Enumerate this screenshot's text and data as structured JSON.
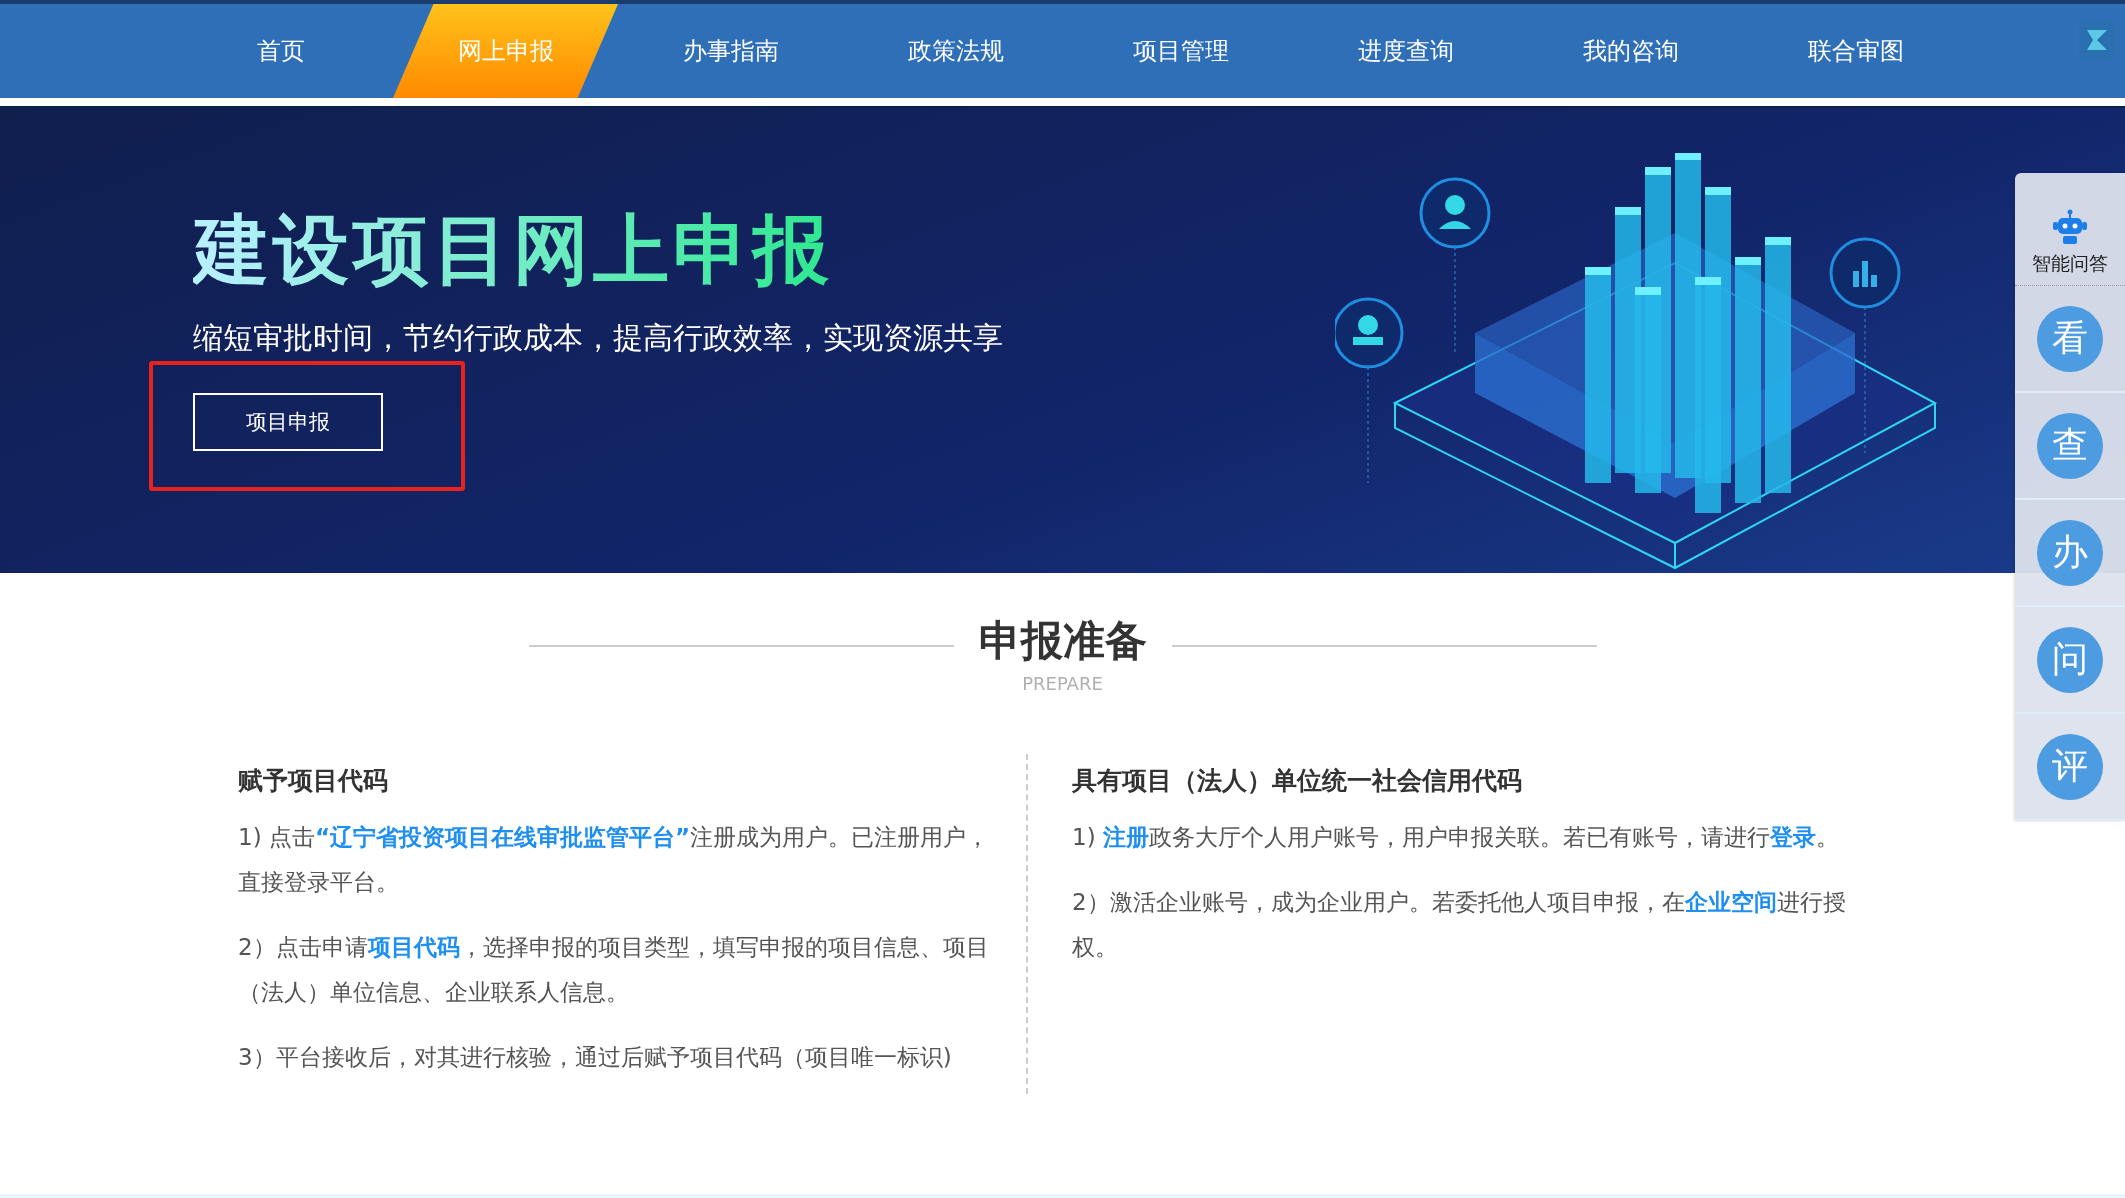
{
  "nav": {
    "items": [
      {
        "label": "首页",
        "selected": false
      },
      {
        "label": "网上申报",
        "selected": true
      },
      {
        "label": "办事指南",
        "selected": false
      },
      {
        "label": "政策法规",
        "selected": false
      },
      {
        "label": "项目管理",
        "selected": false
      },
      {
        "label": "进度查询",
        "selected": false
      },
      {
        "label": "我的咨询",
        "selected": false
      },
      {
        "label": "联合审图",
        "selected": false
      }
    ]
  },
  "hero": {
    "title": "建设项目网上申报",
    "subtitle": "缩短审批时间，节约行政成本，提高行政效率，实现资源共享",
    "button": "项目申报"
  },
  "side_panel": {
    "assistant_label": "智能问答",
    "items": [
      "看",
      "查",
      "办",
      "问",
      "评"
    ]
  },
  "section": {
    "title": "申报准备",
    "subtitle": "PREPARE"
  },
  "columns": [
    {
      "heading": "赋予项目代码",
      "paragraphs": [
        [
          {
            "kind": "text",
            "text": "1) 点击"
          },
          {
            "kind": "link",
            "text": "“辽宁省投资项目在线审批监管平台”"
          },
          {
            "kind": "text",
            "text": "注册成为用户。已注册用户，直接登录平台。"
          }
        ],
        [
          {
            "kind": "text",
            "text": "2）点击申请"
          },
          {
            "kind": "link",
            "text": "项目代码"
          },
          {
            "kind": "text",
            "text": "，选择申报的项目类型，填写申报的项目信息、项目（法人）单位信息、企业联系人信息。"
          }
        ],
        [
          {
            "kind": "text",
            "text": "3）平台接收后，对其进行核验，通过后赋予项目代码（项目唯一标识)"
          }
        ]
      ]
    },
    {
      "heading": "具有项目（法人）单位统一社会信用代码",
      "paragraphs": [
        [
          {
            "kind": "text",
            "text": "1) "
          },
          {
            "kind": "link",
            "text": "注册"
          },
          {
            "kind": "text",
            "text": "政务大厅个人用户账号，用户申报关联。若已有账号，请进行"
          },
          {
            "kind": "link",
            "text": "登录"
          },
          {
            "kind": "text",
            "text": "。"
          }
        ],
        [
          {
            "kind": "text",
            "text": "2）激活企业账号，成为企业用户。若委托他人项目申报，在"
          },
          {
            "kind": "link",
            "text": "企业空间"
          },
          {
            "kind": "text",
            "text": "进行授权。"
          }
        ]
      ]
    }
  ]
}
